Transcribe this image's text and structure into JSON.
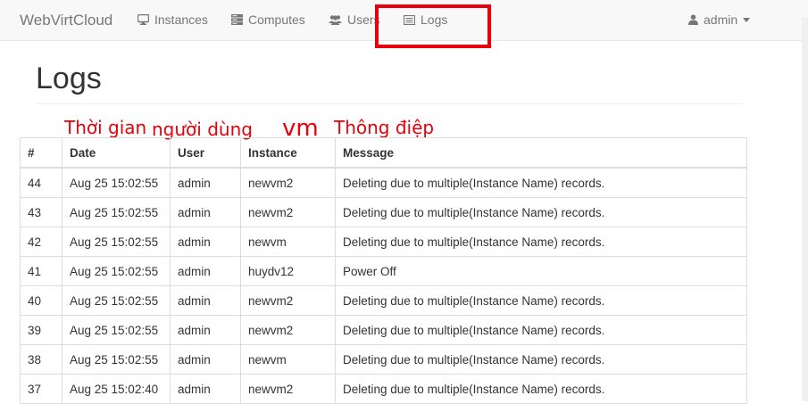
{
  "navbar": {
    "brand": "WebVirtCloud",
    "items": [
      {
        "label": "Instances",
        "icon": "monitor-icon"
      },
      {
        "label": "Computes",
        "icon": "server-icon"
      },
      {
        "label": "Users",
        "icon": "users-icon"
      },
      {
        "label": "Logs",
        "icon": "list-icon"
      }
    ],
    "user": {
      "label": "admin",
      "icon": "user-icon",
      "caret": "caret-down-icon"
    }
  },
  "page": {
    "title": "Logs"
  },
  "annotations": {
    "time": "Thời gian",
    "user": "người dùng",
    "vm": "vm",
    "message": "Thông điệp",
    "color": "#e8000b"
  },
  "table": {
    "headers": [
      "#",
      "Date",
      "User",
      "Instance",
      "Message"
    ],
    "rows": [
      [
        "44",
        "Aug 25 15:02:55",
        "admin",
        "newvm2",
        "Deleting due to multiple(Instance Name) records."
      ],
      [
        "43",
        "Aug 25 15:02:55",
        "admin",
        "newvm2",
        "Deleting due to multiple(Instance Name) records."
      ],
      [
        "42",
        "Aug 25 15:02:55",
        "admin",
        "newvm",
        "Deleting due to multiple(Instance Name) records."
      ],
      [
        "41",
        "Aug 25 15:02:55",
        "admin",
        "huydv12",
        "Power Off"
      ],
      [
        "40",
        "Aug 25 15:02:55",
        "admin",
        "newvm2",
        "Deleting due to multiple(Instance Name) records."
      ],
      [
        "39",
        "Aug 25 15:02:55",
        "admin",
        "newvm2",
        "Deleting due to multiple(Instance Name) records."
      ],
      [
        "38",
        "Aug 25 15:02:55",
        "admin",
        "newvm",
        "Deleting due to multiple(Instance Name) records."
      ],
      [
        "37",
        "Aug 25 15:02:40",
        "admin",
        "newvm2",
        "Deleting due to multiple(Instance Name) records."
      ]
    ]
  }
}
